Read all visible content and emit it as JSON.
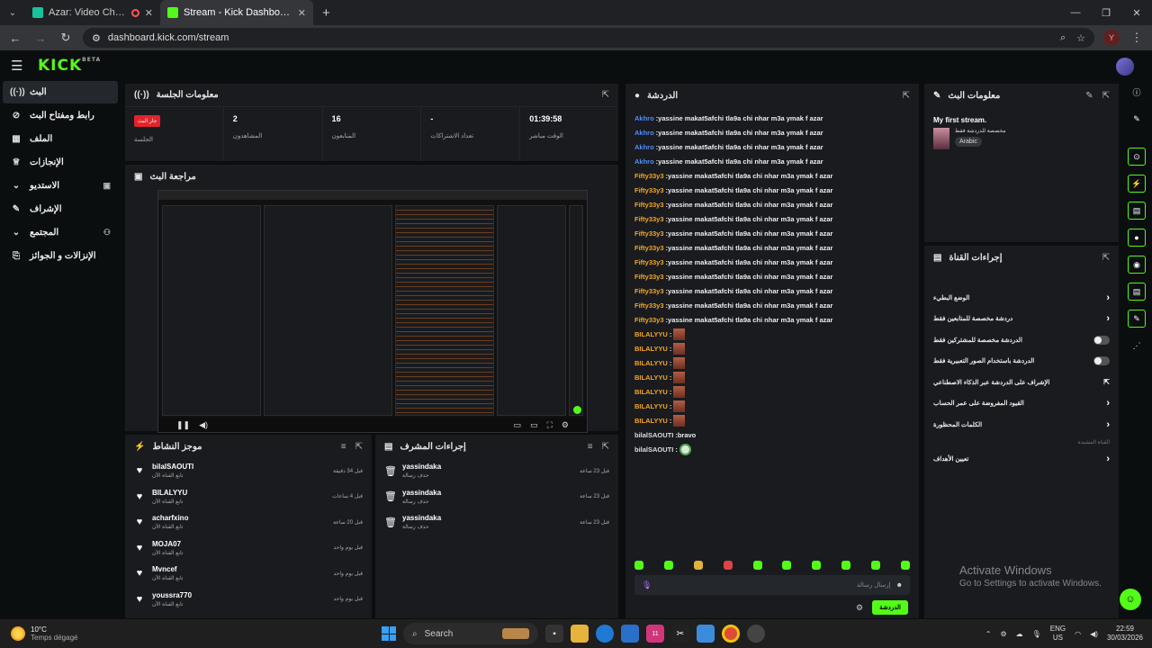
{
  "browser": {
    "tabs": [
      {
        "title": "Azar: Video Chat with New",
        "active": false
      },
      {
        "title": "Stream - Kick Dashboard",
        "active": true
      }
    ],
    "url": "dashboard.kick.com/stream",
    "profile_initial": "Y"
  },
  "app": {
    "logo": "KICK",
    "logo_badge": "BETA"
  },
  "sidebar": {
    "items": [
      {
        "label": "البث",
        "icon": "broadcast-icon",
        "active": true
      },
      {
        "label": "رابط ومفتاح البث",
        "icon": "link-icon"
      },
      {
        "label": "الملف",
        "icon": "profile-icon"
      },
      {
        "label": "الإنجازات",
        "icon": "trophy-icon"
      },
      {
        "label": "الاستديو",
        "icon": "studio-icon",
        "expand": true
      },
      {
        "label": "الإشراف",
        "icon": "wrench-icon"
      },
      {
        "label": "المجتمع",
        "icon": "community-icon",
        "expand": true
      },
      {
        "label": "الإنزالات و الجوائز",
        "icon": "drops-icon"
      }
    ]
  },
  "session": {
    "title": "معلومات الجلسة",
    "live_badge": "جار البث",
    "session_label": "الجلسة",
    "viewers_value": "2",
    "viewers_label": "المشاهدون",
    "followers_value": "16",
    "followers_label": "المتابعون",
    "subs_value": "-",
    "subs_label": "تعداد الاشتراكات",
    "live_time_value": "01:39:58",
    "live_time_label": "الوقت مباشر"
  },
  "preview": {
    "title": "مراجعة البث"
  },
  "activity": {
    "title": "موجز النشاط",
    "items": [
      {
        "name": "bilalSAOUTI",
        "sub": "تابع القناة الآن",
        "time": "قبل 34 دقيقة"
      },
      {
        "name": "BILALYYU",
        "sub": "تابع القناة الآن",
        "time": "قبل 4 ساعات"
      },
      {
        "name": "acharfxino",
        "sub": "تابع القناة الآن",
        "time": "قبل 20 ساعة"
      },
      {
        "name": "MOJA07",
        "sub": "تابع القناة الآن",
        "time": "قبل يوم واحد"
      },
      {
        "name": "Mvncef",
        "sub": "تابع القناة الآن",
        "time": "قبل يوم واحد"
      },
      {
        "name": "youssra770",
        "sub": "تابع القناة الآن",
        "time": "قبل يوم واحد"
      }
    ]
  },
  "mod_actions": {
    "title": "إجراءات المشرف",
    "items": [
      {
        "name": "yassindaka",
        "sub": "حذف رسالة",
        "time": "قبل 23 ساعة"
      },
      {
        "name": "yassindaka",
        "sub": "حذف رسالة",
        "time": "قبل 23 ساعة"
      },
      {
        "name": "yassindaka",
        "sub": "حذف رسالة",
        "time": "قبل 23 ساعة"
      }
    ]
  },
  "chat": {
    "title": "الدردشة",
    "messages": [
      {
        "user": "Akhro",
        "color": "#4f8ff7",
        "text": "yassine makat5afchi tla9a chi nhar m3a ymak f azar"
      },
      {
        "user": "Akhro",
        "color": "#4f8ff7",
        "text": "yassine makat5afchi tla9a chi nhar m3a ymak f azar"
      },
      {
        "user": "Akhro",
        "color": "#4f8ff7",
        "text": "yassine makat5afchi tla9a chi nhar m3a ymak f azar"
      },
      {
        "user": "Akhro",
        "color": "#4f8ff7",
        "text": "yassine makat5afchi tla9a chi nhar m3a ymak f azar"
      },
      {
        "user": "Fifty33y3",
        "color": "#f5a623",
        "text": "yassine makat5afchi tla9a chi nhar m3a ymak f azar"
      },
      {
        "user": "Fifty33y3",
        "color": "#f5a623",
        "text": "yassine makat5afchi tla9a chi nhar m3a ymak f azar"
      },
      {
        "user": "Fifty33y3",
        "color": "#f5a623",
        "text": "yassine makat5afchi tla9a chi nhar m3a ymak f azar"
      },
      {
        "user": "Fifty33y3",
        "color": "#f5a623",
        "text": "yassine makat5afchi tla9a chi nhar m3a ymak f azar"
      },
      {
        "user": "Fifty33y3",
        "color": "#f5a623",
        "text": "yassine makat5afchi tla9a chi nhar m3a ymak f azar"
      },
      {
        "user": "Fifty33y3",
        "color": "#f5a623",
        "text": "yassine makat5afchi tla9a chi nhar m3a ymak f azar"
      },
      {
        "user": "Fifty33y3",
        "color": "#f5a623",
        "text": "yassine makat5afchi tla9a chi nhar m3a ymak f azar"
      },
      {
        "user": "Fifty33y3",
        "color": "#f5a623",
        "text": "yassine makat5afchi tla9a chi nhar m3a ymak f azar"
      },
      {
        "user": "Fifty33y3",
        "color": "#f5a623",
        "text": "yassine makat5afchi tla9a chi nhar m3a ymak f azar"
      },
      {
        "user": "Fifty33y3",
        "color": "#f5a623",
        "text": "yassine makat5afchi tla9a chi nhar m3a ymak f azar"
      },
      {
        "user": "Fifty33y3",
        "color": "#f5a623",
        "text": "yassine makat5afchi tla9a chi nhar m3a ymak f azar"
      },
      {
        "user": "BILALYYU",
        "color": "#f5a623",
        "text": "",
        "emote": true
      },
      {
        "user": "BILALYYU",
        "color": "#f5a623",
        "text": "",
        "emote": true
      },
      {
        "user": "BILALYYU",
        "color": "#f5a623",
        "text": "",
        "emote": true
      },
      {
        "user": "BILALYYU",
        "color": "#f5a623",
        "text": "",
        "emote": true
      },
      {
        "user": "BILALYYU",
        "color": "#f5a623",
        "text": "",
        "emote": true
      },
      {
        "user": "BILALYYU",
        "color": "#f5a623",
        "text": "",
        "emote": true
      },
      {
        "user": "BILALYYU",
        "color": "#f5a623",
        "text": "",
        "emote": true
      },
      {
        "user": "bilalSAOUTI",
        "color": "#dddddd",
        "text": "bravo"
      },
      {
        "user": "bilalSAOUTI",
        "color": "#dddddd",
        "text": "",
        "emote_green": true
      }
    ],
    "input_placeholder": "إرسال رسالة",
    "send_label": "الدردشة"
  },
  "stream_info": {
    "title": "معلومات البث",
    "stream_title": "My first stream.",
    "category": "مخصصة للدردشة فقط",
    "tag": "Arabic"
  },
  "channel_actions": {
    "title": "إجراءات القناة",
    "items": [
      {
        "label": "الوضع البطيء",
        "type": "arrow"
      },
      {
        "label": "دردشة مخصصة للمتابعين فقط",
        "type": "arrow"
      },
      {
        "label": "الدردشة مخصصة للمشتركين فقط",
        "type": "toggle"
      },
      {
        "label": "الدردشة باستخدام الصور التعبيرية فقط",
        "type": "toggle"
      },
      {
        "label": "الإشراف على الدردشة عبر الذكاء الاصطناعي",
        "type": "external"
      },
      {
        "label": "القيود المفروضة على عمر الحساب",
        "type": "arrow"
      },
      {
        "label": "الكلمات المحظورة",
        "type": "arrow"
      }
    ],
    "subheading": "القناة المشيدة",
    "extra_item": "تعيين الأهداف"
  },
  "watermark": {
    "line1": "Activate Windows",
    "line2": "Go to Settings to activate Windows."
  },
  "taskbar": {
    "temp": "10°C",
    "weather": "Temps dégagé",
    "search_label": "Search",
    "lang1": "ENG",
    "lang2": "US",
    "time": "22:59",
    "date": "30/03/2026",
    "notif_badge": "11"
  }
}
